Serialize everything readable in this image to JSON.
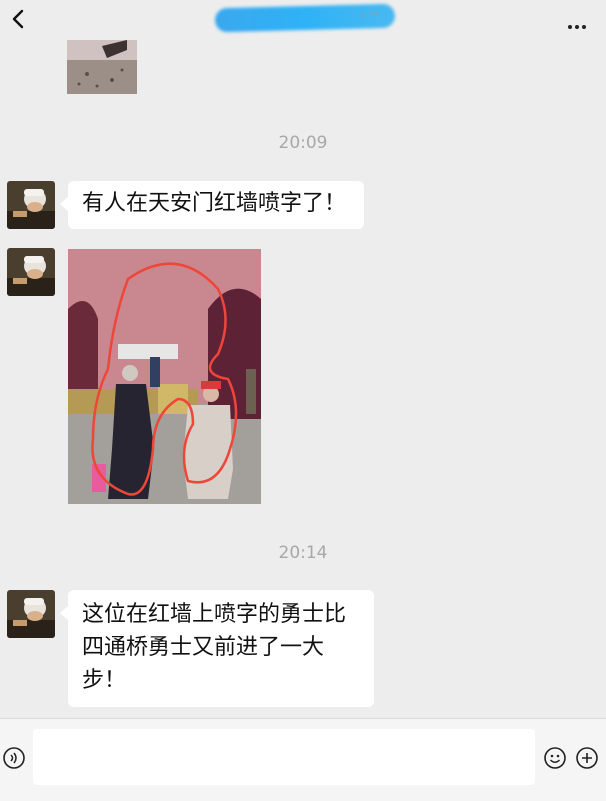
{
  "header": {
    "title_suffix": "• °°",
    "back_icon": "chevron-left-icon",
    "more_icon": "more-dots-icon"
  },
  "messages": [
    {
      "type": "image",
      "thumb": "partial-photo"
    },
    {
      "type": "time",
      "text": "20:09"
    },
    {
      "type": "text",
      "text": "有人在天安门红墙喷字了！"
    },
    {
      "type": "image",
      "thumb": "tiananmen-red-wall-photo"
    },
    {
      "type": "time",
      "text": "20:14"
    },
    {
      "type": "text",
      "lines": [
        "这位在红墙上喷字的勇士比",
        "四通桥勇士又前进了一大",
        "步！"
      ]
    }
  ],
  "input_bar": {
    "voice_icon": "voice-icon",
    "emoji_icon": "emoji-icon",
    "plus_icon": "plus-icon",
    "value": ""
  }
}
